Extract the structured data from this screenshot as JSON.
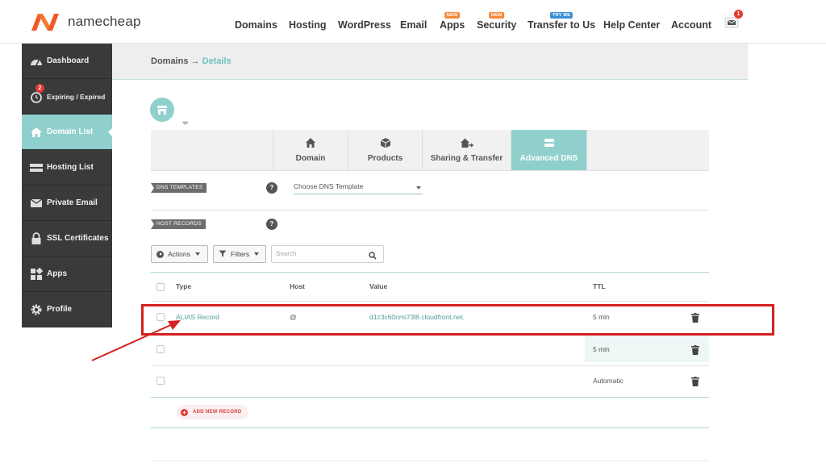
{
  "brand": {
    "name": "namecheap",
    "accent": "#8fd0cc",
    "logo_color": "#f05a28"
  },
  "topnav": {
    "items": [
      {
        "label": "Domains",
        "badge": ""
      },
      {
        "label": "Hosting",
        "badge": ""
      },
      {
        "label": "WordPress",
        "badge": ""
      },
      {
        "label": "Email",
        "badge": ""
      },
      {
        "label": "Apps",
        "badge": "NEW"
      },
      {
        "label": "Security",
        "badge": "NEW"
      },
      {
        "label": "Transfer to Us",
        "badge": "TRY ME"
      },
      {
        "label": "Help Center",
        "badge": ""
      },
      {
        "label": "Account",
        "badge": ""
      }
    ],
    "mail_count": "1",
    "mail_icon": "envelope-icon"
  },
  "sidebar": {
    "items": [
      {
        "label": "Dashboard",
        "icon": "gauge-icon",
        "active": false
      },
      {
        "label": "Expiring / Expired",
        "icon": "clock-icon",
        "active": false,
        "badge": "2"
      },
      {
        "label": "Domain List",
        "icon": "home-icon",
        "active": true
      },
      {
        "label": "Hosting List",
        "icon": "server-icon",
        "active": false
      },
      {
        "label": "Private Email",
        "icon": "envelope-icon",
        "active": false
      },
      {
        "label": "SSL Certificates",
        "icon": "lock-icon",
        "active": false
      },
      {
        "label": "Apps",
        "icon": "apps-icon",
        "active": false
      },
      {
        "label": "Profile",
        "icon": "gear-icon",
        "active": false
      }
    ]
  },
  "breadcrumb": {
    "parent": "Domains",
    "arrow": "→",
    "current": "Details"
  },
  "tabs": [
    {
      "label": "Domain",
      "icon": "home-icon",
      "active": false
    },
    {
      "label": "Products",
      "icon": "box-icon",
      "active": false
    },
    {
      "label": "Sharing & Transfer",
      "icon": "share-home-icon",
      "active": false
    },
    {
      "label": "Advanced DNS",
      "icon": "dns-icon",
      "active": true
    }
  ],
  "dns_templates": {
    "label": "DNS TEMPLATES",
    "help": "?",
    "select_value": "Choose DNS Template"
  },
  "host_records": {
    "label": "HOST RECORDS",
    "help": "?",
    "actions_label": "Actions",
    "filters_label": "Filters",
    "search_placeholder": "Search",
    "columns": {
      "type": "Type",
      "host": "Host",
      "value": "Value",
      "ttl": "TTL"
    },
    "rows": [
      {
        "type": "ALIAS Record",
        "host": "@",
        "value": "d1z3c60nmi73l8.cloudfront.net.",
        "ttl": "5 min"
      },
      {
        "type": "",
        "host": "",
        "value": "",
        "ttl": "5 min"
      },
      {
        "type": "",
        "host": "",
        "value": "",
        "ttl": "Automatic"
      }
    ],
    "add_label": "ADD NEW RECORD"
  },
  "annotation": {
    "color": "#d42020"
  }
}
